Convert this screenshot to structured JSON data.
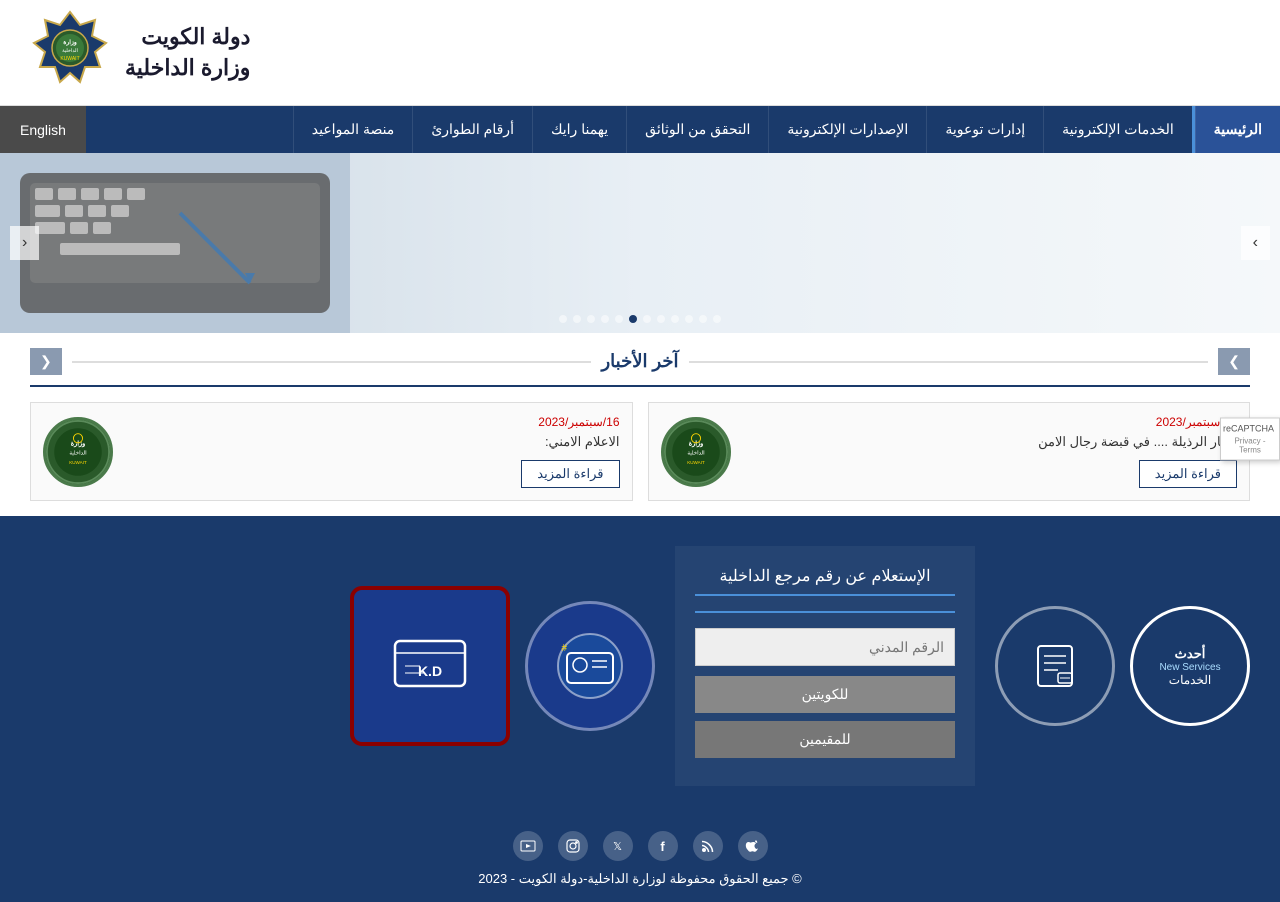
{
  "header": {
    "title_line1": "دولة الكويت",
    "title_line2": "وزارة الداخلية",
    "logo_alt": "Kuwait Police Logo"
  },
  "navbar": {
    "home_label": "الرئيسية",
    "items": [
      {
        "id": "electronic-services",
        "label": "الخدمات الإلكترونية"
      },
      {
        "id": "awareness",
        "label": "إدارات توعوية"
      },
      {
        "id": "publications",
        "label": "الإصدارات الإلكترونية"
      },
      {
        "id": "verify-docs",
        "label": "التحقق من الوثائق"
      },
      {
        "id": "opinion",
        "label": "يهمنا رايك"
      },
      {
        "id": "emergency",
        "label": "أرقام الطوارئ"
      },
      {
        "id": "appointments",
        "label": "منصة المواعيد"
      }
    ],
    "english_label": "English"
  },
  "hero": {
    "dots": [
      1,
      2,
      3,
      4,
      5,
      6,
      7,
      8,
      9,
      10,
      11,
      12
    ],
    "active_dot": 7,
    "prev_label": "‹",
    "next_label": "›"
  },
  "news": {
    "title": "آخر الأخبار",
    "prev_label": "❮",
    "next_label": "❯",
    "cards": [
      {
        "date": "16/سبتمبر/2023",
        "text": "اوكار الرذيلة .... في قبضة رجال الامن",
        "more_label": "قراءة المزيد"
      },
      {
        "date": "16/سبتمبر/2023",
        "text": "الاعلام الامني:",
        "more_label": "قراءة المزيد"
      }
    ]
  },
  "services": {
    "title": "الإستعلام عن رقم مرجع الداخلية",
    "input_placeholder": "الرقم المدني",
    "btn_kuwaiti": "للكويتين",
    "btn_resident": "للمقيمين",
    "new_services_label1": "أحدث",
    "new_services_label2": "New Services",
    "new_services_label3": "الخدمات",
    "circle2_icon": "📋",
    "circle2_label": "",
    "card1_icon": "#≡👤",
    "card1_label": "",
    "card2_icon": "≡ K.D",
    "card2_label": ""
  },
  "footer": {
    "copyright": "© جميع الحقوق محفوظة لوزارة الداخلية-دولة الكويت - 2023",
    "social_icons": [
      "apple",
      "rss",
      "facebook",
      "twitter",
      "instagram",
      "youtube"
    ]
  },
  "recaptcha": {
    "text": "reCAPTCHA",
    "subtext": "Privacy - Terms"
  }
}
